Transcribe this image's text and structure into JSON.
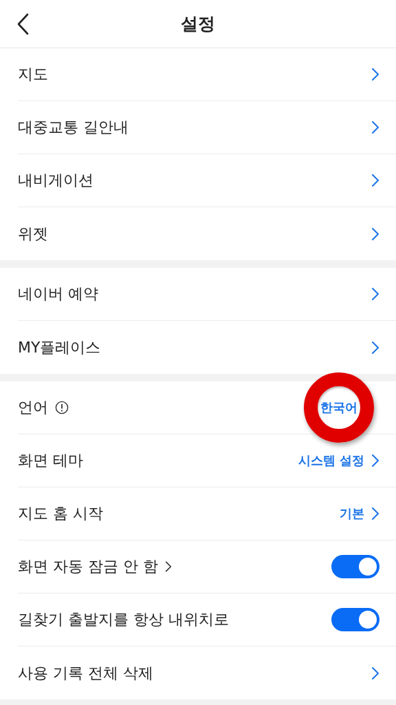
{
  "header": {
    "back": true,
    "title": "설정"
  },
  "sections": [
    {
      "rows": [
        {
          "kind": "link",
          "label": "지도"
        },
        {
          "kind": "link",
          "label": "대중교통 길안내"
        },
        {
          "kind": "link",
          "label": "내비게이션"
        },
        {
          "kind": "link",
          "label": "위젯"
        }
      ]
    },
    {
      "rows": [
        {
          "kind": "link",
          "label": "네이버 예약"
        },
        {
          "kind": "link",
          "label": "MY플레이스"
        }
      ]
    },
    {
      "rows": [
        {
          "kind": "value",
          "label": "언어",
          "info": true,
          "value": "한국어",
          "chevron": false,
          "highlighted": true
        },
        {
          "kind": "value",
          "label": "화면 테마",
          "value": "시스템 설정",
          "chevron": true,
          "highlighted": false
        },
        {
          "kind": "value",
          "label": "지도 홈 시작",
          "value": "기본",
          "chevron": true,
          "highlighted": false
        },
        {
          "kind": "toggle",
          "label": "화면 자동 잠금 안 함",
          "label_chevron": true,
          "on": true
        },
        {
          "kind": "toggle",
          "label": "길찾기 출발지를 항상 내위치로",
          "label_chevron": false,
          "on": true
        },
        {
          "kind": "link",
          "label": "사용 기록 전체 삭제"
        }
      ]
    }
  ]
}
